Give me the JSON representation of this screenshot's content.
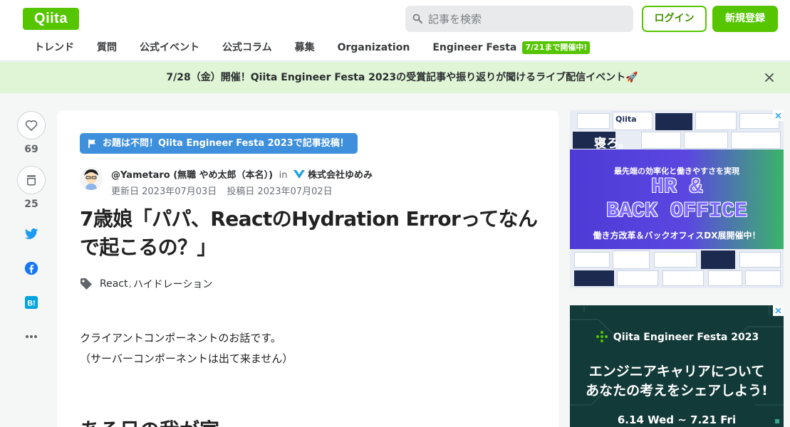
{
  "header": {
    "logo": "Qiita",
    "search": {
      "placeholder": "記事を検索"
    },
    "login_label": "ログイン",
    "signup_label": "新規登録",
    "nav": [
      {
        "label": "トレンド"
      },
      {
        "label": "質問"
      },
      {
        "label": "公式イベント"
      },
      {
        "label": "公式コラム"
      },
      {
        "label": "募集"
      },
      {
        "label": "Organization"
      },
      {
        "label": "Engineer Festa"
      }
    ],
    "nav_badge": "7/21まで開催中!"
  },
  "banner": {
    "text": "7/28（金）開催！Qiita Engineer Festa 2023の受賞記事や振り返りが聞けるライブ配信イベント🚀"
  },
  "actions": {
    "likes": "69",
    "stocks": "25"
  },
  "article": {
    "campaign": "お題は不問！Qiita Engineer Festa 2023で記事投稿！",
    "author": "@Yametaro (無職 やめ太郎（本名）)",
    "in": "in",
    "organization": "株式会社ゆめみ",
    "updated": "更新日 2023年07月03日",
    "posted": "投稿日 2023年07月02日",
    "title": "7歳娘「パパ、ReactのHydration Errorってなんで起こるの？」",
    "tags": [
      "React",
      "ハイドレーション"
    ],
    "body": [
      "クライアントコンポーネントのお話です。",
      "（サーバーコンポーネントは出て来ません）"
    ],
    "heading": "ある日の我が家"
  },
  "ads": {
    "ad1": {
      "brand": "Qiita",
      "lead": "最先端の効率化と働きやすさを実現",
      "headline1": "HR &",
      "headline2": "BACK OFFICE",
      "sub": "働き方改革＆バックオフィスDX展開催中！",
      "side_text": "寝ろ。"
    },
    "ad2": {
      "brand": "Qiita Engineer Festa 2023",
      "line1": "エンジニアキャリアについて",
      "line2": "あなたの考えをシェアしよう!",
      "dates": "6.14 Wed ~ 7.21 Fri"
    }
  },
  "colors": {
    "brand_green": "#55c500",
    "campaign_blue": "#3e8fdc",
    "banner_bg": "#dff5d6"
  }
}
